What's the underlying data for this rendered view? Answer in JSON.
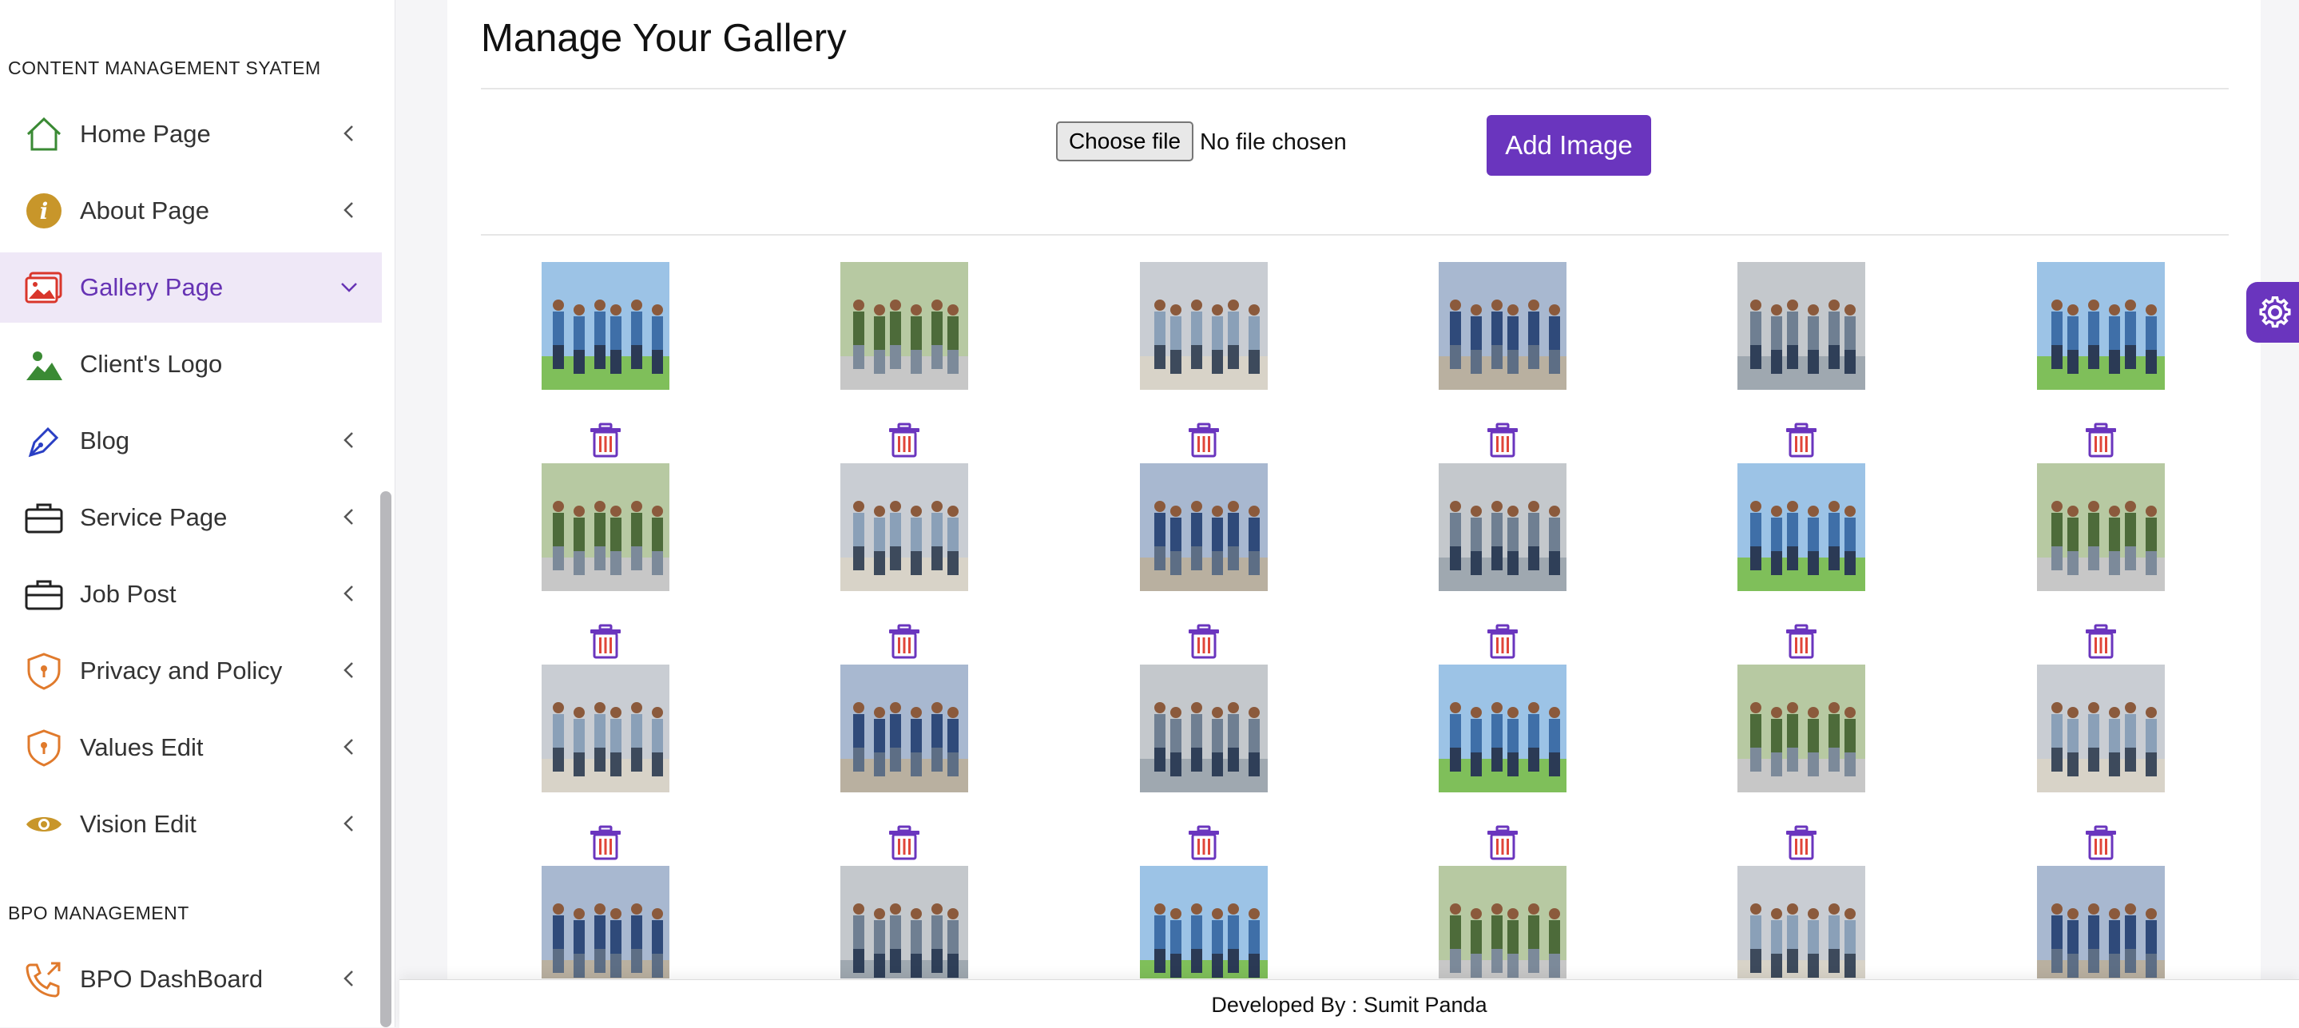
{
  "sidebar": {
    "section1": "CONTENT MANAGEMENT SYATEM",
    "section2": "BPO MANAGEMENT",
    "items": [
      {
        "label": "Home Page",
        "icon": "home-icon"
      },
      {
        "label": "About Page",
        "icon": "info-icon"
      },
      {
        "label": "Gallery Page",
        "icon": "image-icon",
        "active": true
      },
      {
        "label": "Client's Logo",
        "icon": "landscape-icon"
      },
      {
        "label": "Blog",
        "icon": "pen-icon"
      },
      {
        "label": "Service Page",
        "icon": "briefcase-icon"
      },
      {
        "label": "Job Post",
        "icon": "briefcase-icon"
      },
      {
        "label": "Privacy and Policy",
        "icon": "shield-icon"
      },
      {
        "label": "Values Edit",
        "icon": "shield-icon"
      },
      {
        "label": "Vision Edit",
        "icon": "eye-icon"
      },
      {
        "label": "BPO DashBoard",
        "icon": "phone-outgoing-icon"
      }
    ]
  },
  "main": {
    "title": "Manage Your Gallery",
    "file_button": "Choose file",
    "file_status": "No file chosen",
    "add_button": "Add Image"
  },
  "footer": {
    "text": "Developed By : Sumit Panda"
  },
  "colors": {
    "accent": "#6a35be",
    "trash_red": "#e0463a"
  }
}
